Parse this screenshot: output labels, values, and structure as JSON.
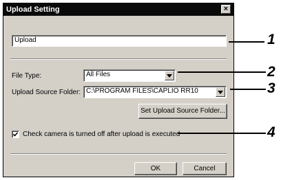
{
  "dialog": {
    "title": "Upload Setting",
    "close_symbol": "×",
    "name_value": "Upload",
    "file_type_label": "File Type:",
    "file_type_value": "All Files",
    "source_folder_label": "Upload Source Folder:",
    "source_folder_value": "C:\\PROGRAM FILES\\CAPLIO RR10",
    "set_folder_button": "Set Upload Source Folder...",
    "checkbox_label": "Check camera is turned off after upload is executed",
    "checkbox_checked": true,
    "ok_button": "OK",
    "cancel_button": "Cancel"
  },
  "callouts": [
    "1",
    "2",
    "3",
    "4"
  ]
}
